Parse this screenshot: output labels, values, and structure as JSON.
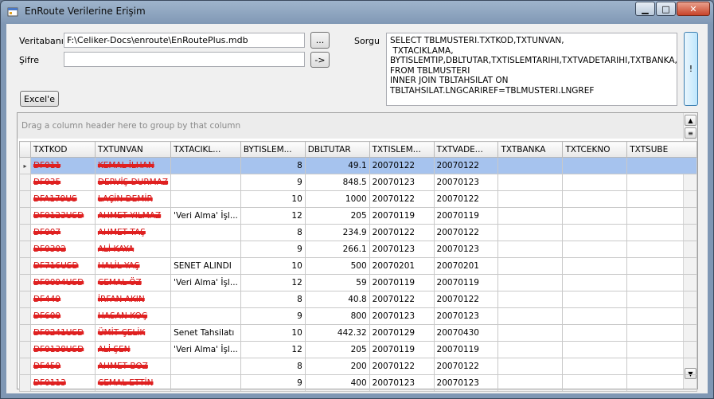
{
  "window": {
    "title": "EnRoute Verilerine Erişim",
    "minimize_glyph": "▁",
    "maximize_glyph": "□",
    "close_glyph": "✕"
  },
  "form": {
    "database_label": "Veritabanı",
    "database_value": "F:\\Celiker-Docs\\enroute\\EnRoutePlus.mdb",
    "browse_label": "...",
    "password_label": "Şifre",
    "password_value": "",
    "connect_label": "->",
    "excel_label": "Excel'e",
    "query_label": "Sorgu",
    "query_value": "SELECT TBLMUSTERI.TXTKOD,TXTUNVAN,\n TXTACIKLAMA,\nBYTISLEMTIP,DBLTUTAR,TXTISLEMTARIHI,TXTVADETARIHI,TXTBANKA,TXTCEKNO,TXTSUBE FROM TBLMUSTERI\nINNER JOIN TBLTAHSILAT ON\nTBLTAHSILAT.LNGCARIREF=TBLMUSTERI.LNGREF",
    "execute_label": "!"
  },
  "grid": {
    "group_hint": "Drag a column header here to group by that column",
    "columns": [
      "TXTKOD",
      "TXTUNVAN",
      "TXTACIKL...",
      "BYTISLEM...",
      "DBLTUTAR",
      "TXTISLEM...",
      "TXTVADE...",
      "TXTBANKA",
      "TXTCEKNO",
      "TXTSUBE"
    ],
    "rows": [
      [
        "DF011",
        "KEMAL İLHAN",
        "",
        "8",
        "49.1",
        "20070122",
        "20070122",
        "",
        "",
        ""
      ],
      [
        "DF035",
        "DERVİŞ DURMAZ",
        "",
        "9",
        "848.5",
        "20070123",
        "20070123",
        "",
        "",
        ""
      ],
      [
        "DFA179US",
        "LAÇİN DEMİR",
        "",
        "10",
        "1000",
        "20070122",
        "20070122",
        "",
        "",
        ""
      ],
      [
        "DF0123USD",
        "AHMET YILMAZ",
        "'Veri Alma' İşl...",
        "12",
        "205",
        "20070119",
        "20070119",
        "",
        "",
        ""
      ],
      [
        "DF007",
        "AHMET TAŞ",
        "",
        "8",
        "234.9",
        "20070122",
        "20070122",
        "",
        "",
        ""
      ],
      [
        "DF0302",
        "ALİ KAYA",
        "",
        "9",
        "266.1",
        "20070123",
        "20070123",
        "",
        "",
        ""
      ],
      [
        "DF716USD",
        "HALİL YAŞ",
        "SENET ALINDI",
        "10",
        "500",
        "20070201",
        "20070201",
        "",
        "",
        ""
      ],
      [
        "DF0094USD",
        "CEMAL ÖZ",
        "'Veri Alma' İşl...",
        "12",
        "59",
        "20070119",
        "20070119",
        "",
        "",
        ""
      ],
      [
        "DF449",
        "İRFAN AKIN",
        "",
        "8",
        "40.8",
        "20070122",
        "20070122",
        "",
        "",
        ""
      ],
      [
        "DF600",
        "HASAN KOÇ",
        "",
        "9",
        "800",
        "20070123",
        "20070123",
        "",
        "",
        ""
      ],
      [
        "DF0241USD",
        "ÜMİT ÇELİK",
        "Senet Tahsilatı",
        "10",
        "442.32",
        "20070129",
        "20070430",
        "",
        "",
        ""
      ],
      [
        "DF0138USD",
        "ALİ ŞEN",
        "'Veri Alma' İşl...",
        "12",
        "205",
        "20070119",
        "20070119",
        "",
        "",
        ""
      ],
      [
        "DF459",
        "AHMET BOZ",
        "",
        "8",
        "200",
        "20070122",
        "20070122",
        "",
        "",
        ""
      ],
      [
        "DF0113",
        "CEMAL ETTİN",
        "",
        "9",
        "400",
        "20070123",
        "20070123",
        "",
        "",
        ""
      ]
    ],
    "selected_row": 0,
    "redacted_columns": [
      0,
      1
    ]
  },
  "icons": {
    "app": "app-window-icon",
    "row_indicator": "▸",
    "scroll_up": "▲",
    "scroll_down": "▼",
    "chooser": "≡"
  },
  "colors": {
    "selection": "#a6c3ee",
    "redaction": "#e02020"
  }
}
